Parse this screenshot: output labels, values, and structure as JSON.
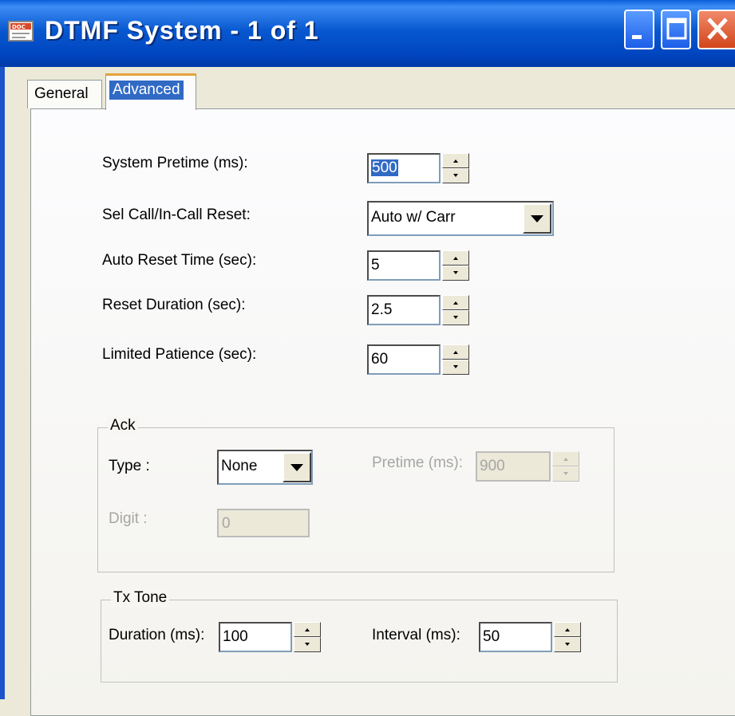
{
  "window": {
    "title": "DTMF System - 1 of 1",
    "app_icon_text": "DOC"
  },
  "tabs": [
    {
      "label": "General",
      "selected": false
    },
    {
      "label": "Advanced",
      "selected": true
    }
  ],
  "form": {
    "system_pretime": {
      "label": "System Pretime (ms):",
      "value": "500"
    },
    "sel_call_reset": {
      "label": "Sel Call/In-Call Reset:",
      "value": "Auto w/ Carr"
    },
    "auto_reset_time": {
      "label": "Auto Reset Time (sec):",
      "value": "5"
    },
    "reset_duration": {
      "label": "Reset Duration (sec):",
      "value": "2.5"
    },
    "limited_patience": {
      "label": "Limited Patience (sec):",
      "value": "60"
    }
  },
  "ack": {
    "legend": "Ack",
    "type": {
      "label": "Type :",
      "value": "None"
    },
    "pretime": {
      "label": "Pretime (ms):",
      "value": "900"
    },
    "digit": {
      "label": "Digit :",
      "value": "0"
    }
  },
  "tx_tone": {
    "legend": "Tx Tone",
    "duration": {
      "label": "Duration (ms):",
      "value": "100"
    },
    "interval": {
      "label": "Interval (ms):",
      "value": "50"
    }
  }
}
